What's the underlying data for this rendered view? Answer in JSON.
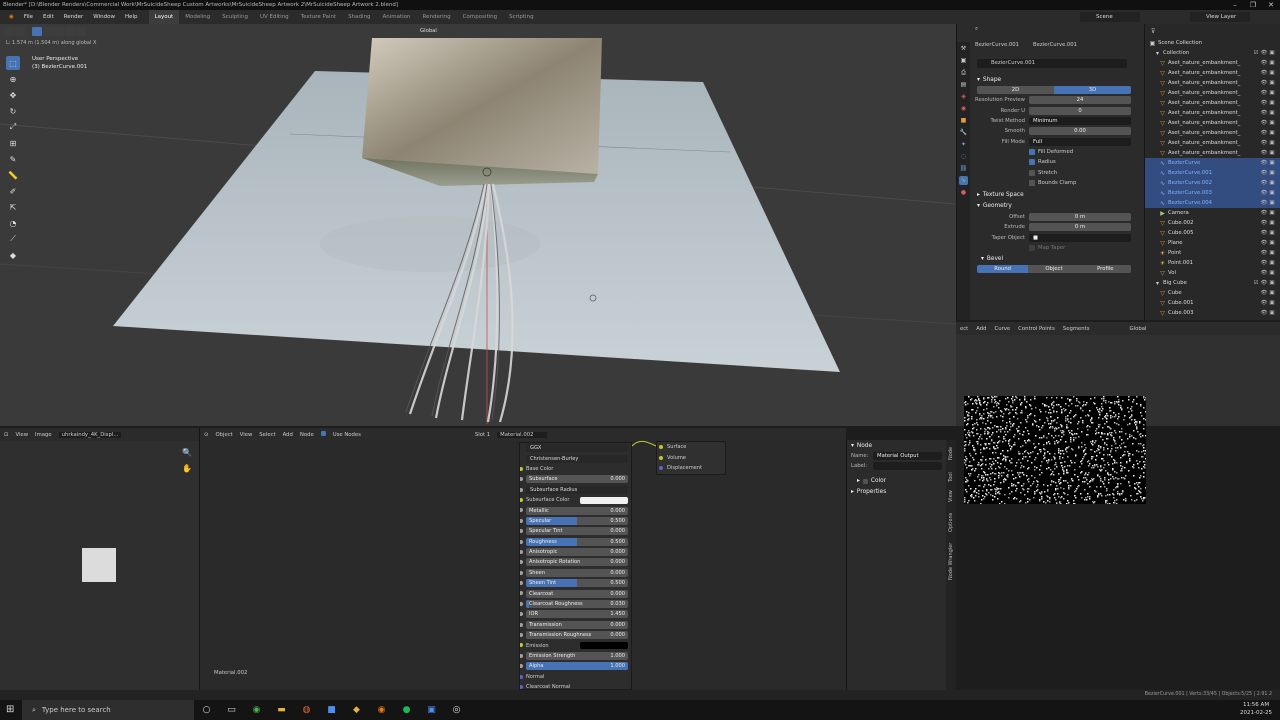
{
  "window": {
    "title": "Blender* [D:\\Blender Renders\\Commercial Work\\MrSuicideSheep Custom Artworks\\MrSuicideSheep Artwork 2\\MrSuicideSheep Artwork 2.blend]",
    "controls": [
      "–",
      "❐",
      "✕"
    ]
  },
  "menu": [
    "File",
    "Edit",
    "Render",
    "Window",
    "Help"
  ],
  "workspaces": [
    "Layout",
    "Modeling",
    "Sculpting",
    "UV Editing",
    "Texture Paint",
    "Shading",
    "Animation",
    "Rendering",
    "Compositing",
    "Scripting"
  ],
  "scene": "Scene",
  "view_layer": "View Layer",
  "viewport": {
    "status": "L: 1.574 m (1.504 m) along global X",
    "perspective": "User Perspective",
    "object": "(3) BezierCurve.001",
    "orientation": "Global"
  },
  "outliner": {
    "root": "Scene Collection",
    "collection": "Collection",
    "items": [
      {
        "name": "Aset_nature_embankment_",
        "sel": false,
        "icon": "▽"
      },
      {
        "name": "Aset_nature_embankment_",
        "sel": false,
        "icon": "▽"
      },
      {
        "name": "Aset_nature_embankment_",
        "sel": false,
        "icon": "▽"
      },
      {
        "name": "Aset_nature_embankment_",
        "sel": false,
        "icon": "▽"
      },
      {
        "name": "Aset_nature_embankment_",
        "sel": false,
        "icon": "▽"
      },
      {
        "name": "Aset_nature_embankment_",
        "sel": false,
        "icon": "▽"
      },
      {
        "name": "Aset_nature_embankment_",
        "sel": false,
        "icon": "▽"
      },
      {
        "name": "Aset_nature_embankment_",
        "sel": false,
        "icon": "▽"
      },
      {
        "name": "Aset_nature_embankment_",
        "sel": false,
        "icon": "▽"
      },
      {
        "name": "Aset_nature_embankment_",
        "sel": false,
        "icon": "▽"
      },
      {
        "name": "BezierCurve",
        "sel": true,
        "icon": "∿"
      },
      {
        "name": "BezierCurve.001",
        "sel": true,
        "icon": "∿"
      },
      {
        "name": "BezierCurve.002",
        "sel": true,
        "icon": "∿"
      },
      {
        "name": "BezierCurve.003",
        "sel": true,
        "icon": "∿"
      },
      {
        "name": "BezierCurve.004",
        "sel": true,
        "icon": "∿"
      },
      {
        "name": "Camera",
        "sel": false,
        "icon": "▶"
      },
      {
        "name": "Cube.002",
        "sel": false,
        "icon": "▽"
      },
      {
        "name": "Cube.005",
        "sel": false,
        "icon": "▽"
      },
      {
        "name": "Plane",
        "sel": false,
        "icon": "▽"
      },
      {
        "name": "Point",
        "sel": false,
        "icon": "☀"
      },
      {
        "name": "Point.001",
        "sel": false,
        "icon": "☀"
      },
      {
        "name": "Vol",
        "sel": false,
        "icon": "▽"
      }
    ],
    "big_cube": "Big Cube",
    "big_cube_items": [
      "Cube",
      "Cube.001",
      "Cube.003"
    ]
  },
  "properties": {
    "breadcrumb_object": "BezierCurve.001",
    "breadcrumb_data": "BezierCurve.001",
    "datablock": "BezierCurve.001",
    "shape_section": "Shape",
    "dim_2d": "2D",
    "dim_3d": "3D",
    "rows": [
      {
        "label": "Resolution Preview",
        "value": "24"
      },
      {
        "label": "Render U",
        "value": "0"
      },
      {
        "label": "Twist Method",
        "value": "Minimum",
        "dark": true
      },
      {
        "label": "Smooth",
        "value": "0.00"
      },
      {
        "label": "Fill Mode",
        "value": "Full",
        "dark": true
      }
    ],
    "checks": [
      {
        "label": "Fill Deformed",
        "on": true
      },
      {
        "label": "Radius",
        "on": true
      },
      {
        "label": "Stretch",
        "on": false
      },
      {
        "label": "Bounds Clamp",
        "on": false
      }
    ],
    "texture_space": "Texture Space",
    "geometry": "Geometry",
    "geo_rows": [
      {
        "label": "Offset",
        "value": "0 m"
      },
      {
        "label": "Extrude",
        "value": "0 m"
      }
    ],
    "taper_label": "Taper Object",
    "map_taper": "Map Taper",
    "bevel": "Bevel",
    "bevel_modes": [
      "Round",
      "Object",
      "Profile"
    ]
  },
  "uv_header": [
    "ect",
    "Add",
    "Curve",
    "Control Points",
    "Segments",
    "Global"
  ],
  "image_editor_header": [
    "View",
    "Image",
    "uhrkaindy_4K_Displ..."
  ],
  "node_header": [
    "Object",
    "View",
    "Select",
    "Add",
    "Node",
    "Use Nodes",
    "Slot 1",
    "Material.002"
  ],
  "material_label": "Material.002",
  "bsdf": {
    "distribution": "GGX",
    "subsurface_method": "Christensen-Burley",
    "rows": [
      {
        "label": "Base Color",
        "type": "label",
        "sock": "y"
      },
      {
        "label": "Subsurface",
        "value": "0.000",
        "fill": 0
      },
      {
        "label": "Subsurface Radius",
        "type": "dropdown"
      },
      {
        "label": "Subsurface Color",
        "type": "swatch",
        "color": "#f0f0f0",
        "sock": "y"
      },
      {
        "label": "Metallic",
        "value": "0.000",
        "fill": 0
      },
      {
        "label": "Specular",
        "value": "0.500",
        "fill": 0.5
      },
      {
        "label": "Specular Tint",
        "value": "0.000",
        "fill": 0
      },
      {
        "label": "Roughness",
        "value": "0.500",
        "fill": 0.5
      },
      {
        "label": "Anisotropic",
        "value": "0.000",
        "fill": 0
      },
      {
        "label": "Anisotropic Rotation",
        "value": "0.000",
        "fill": 0
      },
      {
        "label": "Sheen",
        "value": "0.000",
        "fill": 0
      },
      {
        "label": "Sheen Tint",
        "value": "0.500",
        "fill": 0.5
      },
      {
        "label": "Clearcoat",
        "value": "0.000",
        "fill": 0
      },
      {
        "label": "Clearcoat Roughness",
        "value": "0.030",
        "fill": 0.03
      },
      {
        "label": "IOR",
        "value": "1.450",
        "fill": 0
      },
      {
        "label": "Transmission",
        "value": "0.000",
        "fill": 0
      },
      {
        "label": "Transmission Roughness",
        "value": "0.000",
        "fill": 0
      },
      {
        "label": "Emission",
        "type": "swatch",
        "color": "#000000",
        "sock": "y"
      },
      {
        "label": "Emission Strength",
        "value": "1.000",
        "fill": 0
      },
      {
        "label": "Alpha",
        "value": "1.000",
        "fill": 1
      },
      {
        "label": "Normal",
        "type": "label",
        "sock": "p"
      },
      {
        "label": "Clearcoat Normal",
        "type": "label",
        "sock": "p"
      }
    ]
  },
  "output_node": [
    "Surface",
    "Volume",
    "Displacement"
  ],
  "npanel": {
    "section": "Node",
    "name_label": "Name:",
    "name_value": "Material Output",
    "label_label": "Label:",
    "color": "Color",
    "properties": "Properties",
    "tabs": [
      "Node",
      "Tool",
      "View",
      "Options",
      "Node Wrangler"
    ]
  },
  "statusbar_right": "BezierCurve.001 | Verts:33/45 | Objects:5/25 | 2.91.2",
  "taskbar": {
    "search_placeholder": "Type here to search",
    "time": "11:56 AM",
    "date": "2021-02-25"
  }
}
